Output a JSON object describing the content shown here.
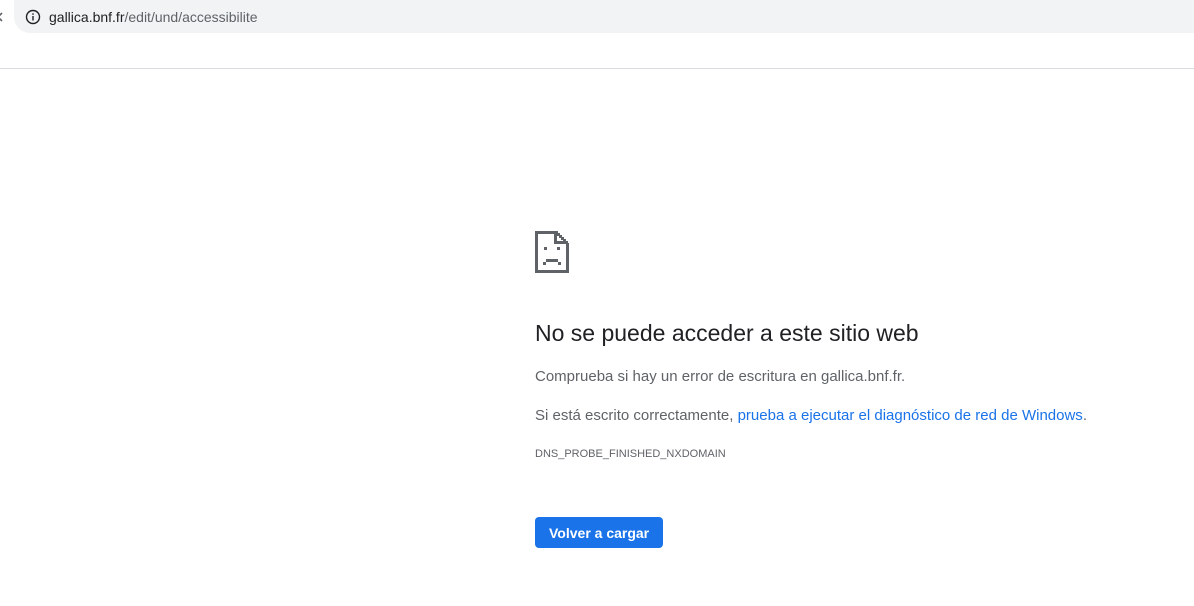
{
  "address_bar": {
    "host": "gallica.bnf.fr",
    "path": "/edit/und/accessibilite"
  },
  "error_page": {
    "icon": "sad-document-icon",
    "headline": "No se puede acceder a este sitio web",
    "check_typo_text": "Comprueba si hay un error de escritura en gallica.bnf.fr.",
    "if_correct_prefix": "Si está escrito correctamente, ",
    "diagnostics_link": "prueba a ejecutar el diagnóstico de red de Windows",
    "if_correct_suffix": ".",
    "error_code": "DNS_PROBE_FINISHED_NXDOMAIN",
    "reload_label": "Volver a cargar"
  },
  "colors": {
    "link": "#1a73e8",
    "button_bg": "#1a73e8",
    "text_primary": "#202124",
    "text_secondary": "#5f6368",
    "omnibox_bg": "#f1f3f4"
  }
}
